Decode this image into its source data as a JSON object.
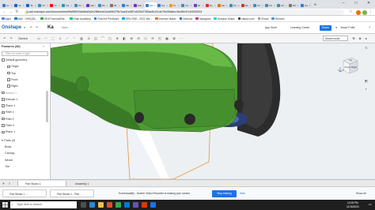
{
  "browser": {
    "tabs": [
      {
        "label": "Lo",
        "color": "#2b7bd8"
      },
      {
        "label": "Ta",
        "color": "#0a66c2"
      },
      {
        "label": "Ta",
        "color": "#0a66c2"
      },
      {
        "label": "Ch",
        "color": "#3c8dbc"
      },
      {
        "label": "Yo",
        "color": "#ff0000"
      },
      {
        "label": "Pa",
        "color": "#3c8dbc"
      },
      {
        "label": "Ch",
        "color": "#3c8dbc"
      },
      {
        "label": "Ask",
        "color": "#7b2fb5"
      },
      {
        "label": "Pa",
        "color": "#3c8dbc"
      },
      {
        "label": "Wi",
        "color": "#777777"
      },
      {
        "label": "Me",
        "color": "#2b7bd8"
      },
      {
        "label": "Ask",
        "color": "#7b2fb5"
      },
      {
        "label": "Ka",
        "color": "#2b7bd8"
      },
      {
        "label": "Ka",
        "color": "#2b7bd8"
      },
      {
        "label": "Ki",
        "color": "#f0a000"
      },
      {
        "label": "Ch",
        "color": "#3c8dbc"
      },
      {
        "label": "Ab",
        "color": "#6a3ec2"
      },
      {
        "label": "Re",
        "color": "#d93025"
      },
      {
        "label": "Ga",
        "color": "#e37400"
      },
      {
        "label": "Ch",
        "color": "#3c8dbc"
      },
      {
        "label": "Re",
        "color": "#d93025"
      },
      {
        "label": "Ch",
        "color": "#3c8dbc"
      },
      {
        "label": "Ch",
        "color": "#3c8dbc"
      },
      {
        "label": "Ch",
        "color": "#3c8dbc"
      },
      {
        "label": "RC",
        "color": "#777777"
      },
      {
        "label": "Ka",
        "color": "#2b7bd8"
      }
    ],
    "active_tab_index": 12,
    "new_tab": "+",
    "url": "cad.onshape.com/documents/ef9a98920de6bd2a0c2f8be4e2a4a9b37fb7cca3/w/8f7c62f4d73f5ac8c12c4e7f/e/f5a6ec3bcf5ed7c1f2fd3004",
    "bookmarks": [
      {
        "label": "Apps",
        "color": "#4285f4"
      },
      {
        "label": "Mail - VHSQ04...",
        "color": "#0078d4"
      },
      {
        "label": "OEA FormulaShe...",
        "color": "#34a853"
      },
      {
        "label": "Khan Academy",
        "color": "#14bf96"
      },
      {
        "label": "Field Kit PrintMore",
        "color": "#2b7bd8"
      },
      {
        "label": "EPA 2020 - 2021 We...",
        "color": "#00a4ef"
      },
      {
        "label": "Inventor Maker",
        "color": "#f36f21"
      },
      {
        "label": "Desmos",
        "color": "#2d70b3"
      },
      {
        "label": "Instagram",
        "color": "#c13584"
      },
      {
        "label": "Amazon Music",
        "color": "#25d1da"
      },
      {
        "label": "classo.com",
        "color": "#444444"
      },
      {
        "label": "iCloud",
        "color": "#999999"
      },
      {
        "label": "Remind",
        "color": "#4a90e2"
      }
    ]
  },
  "onshape": {
    "logo": "Onshape",
    "menu_icon": "≡",
    "undo_icon": "↶",
    "redo_icon": "↷",
    "doc_name": "Ka",
    "branch": "Main",
    "app_store": "App Store",
    "learning_center": "Learning Center",
    "share": "Share",
    "user_name": "Jesse Fotid",
    "help_icon": "?",
    "sketch_label": "Sketch",
    "search_tools": "Search tools",
    "features": {
      "title": "Features (30)",
      "filter_placeholder": "Filter by name or type",
      "rows": [
        {
          "label": "Default geometry",
          "indent": false,
          "dim": false
        },
        {
          "label": "Origin",
          "indent": true,
          "dim": false
        },
        {
          "label": "Top",
          "indent": true,
          "dim": false
        },
        {
          "label": "Front",
          "indent": true,
          "dim": false
        },
        {
          "label": "Right",
          "indent": true,
          "dim": false
        },
        {
          "label": "Sketch 1",
          "indent": false,
          "dim": true
        },
        {
          "label": "Extrude 1",
          "indent": false,
          "dim": false
        },
        {
          "label": "Plane 1",
          "indent": false,
          "dim": false
        },
        {
          "label": "Fillet 1",
          "indent": false,
          "dim": false
        },
        {
          "label": "Fillet 2",
          "indent": false,
          "dim": false
        },
        {
          "label": "Fillet 3",
          "indent": false,
          "dim": false
        },
        {
          "label": "Plane 1",
          "indent": false,
          "dim": false
        }
      ],
      "parts_title": "Parts (4)",
      "parts": [
        "Body",
        "Canopy",
        "Wheel",
        "Tire"
      ]
    },
    "viewcube": {
      "front": "Front",
      "top": "Top",
      "right": "Right",
      "axis_x": "X",
      "axis_y": "Y",
      "axis_z": "Z"
    },
    "bottom_tabs": [
      "Part Studio 1",
      "Assembly 1"
    ],
    "add_tab_icon": "+"
  },
  "screencastify": {
    "chips": [
      "Part Studio 1 ...",
      "Part Studio 1 - Part..."
    ],
    "message": "Screencastify - Screen Video Recorder is sharing your screen.",
    "stop_label": "Stop sharing",
    "hide_label": "Hide",
    "show_all": "Show all"
  },
  "taskbar": {
    "search_placeholder": "Type here to search",
    "time": "12:08 PM",
    "date": "11/16/2020",
    "icons": [
      "#4f4f4f",
      "#2b88d8",
      "#f3c04b",
      "#e44d26",
      "#34a853",
      "#0078d4",
      "#6b4fbb",
      "#d83b01",
      "#1a73e8"
    ]
  }
}
